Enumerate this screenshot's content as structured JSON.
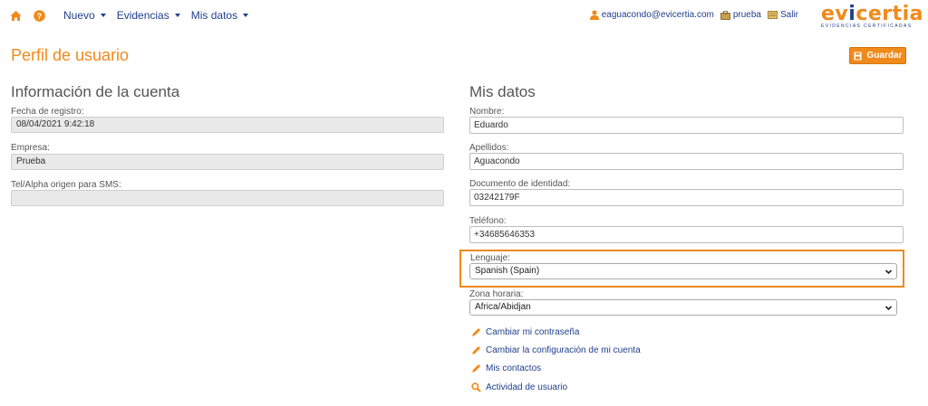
{
  "nav": {
    "menu": [
      {
        "label": "Nuevo"
      },
      {
        "label": "Evidencias"
      },
      {
        "label": "Mis datos"
      }
    ],
    "user_email": "eaguacondo@evicertia.com",
    "account": "prueba",
    "logout": "Salir"
  },
  "logo": {
    "part1": "ev",
    "part2": "i",
    "part3": "certia",
    "tagline": "EVIDENCIAS CERTIFICADAS"
  },
  "page": {
    "title": "Perfil de usuario",
    "save_label": "Guardar"
  },
  "account_info": {
    "title": "Información de la cuenta",
    "registration_label": "Fecha de registro:",
    "registration_value": "08/04/2021 9:42:18",
    "company_label": "Empresa:",
    "company_value": "Prueba",
    "sms_label": "Tel/Alpha origen para SMS:",
    "sms_value": ""
  },
  "my_data": {
    "title": "Mis datos",
    "name_label": "Nombre:",
    "name_value": "Eduardo",
    "surname_label": "Apellidos:",
    "surname_value": "Aguacondo",
    "id_label": "Documento de identidad:",
    "id_value": "03242179F",
    "phone_label": "Teléfono:",
    "phone_value": "+34685646353",
    "language_label": "Lenguaje:",
    "language_value": "Spanish (Spain)",
    "timezone_label": "Zona horaria:",
    "timezone_value": "Africa/Abidjan"
  },
  "links": {
    "change_password": "Cambiar mi contraseña",
    "change_config": "Cambiar la configuración de mi cuenta",
    "contacts": "Mis contactos",
    "activity": "Actividad de usuario"
  },
  "colors": {
    "accent": "#f08a1b",
    "link": "#1f3f8c"
  }
}
